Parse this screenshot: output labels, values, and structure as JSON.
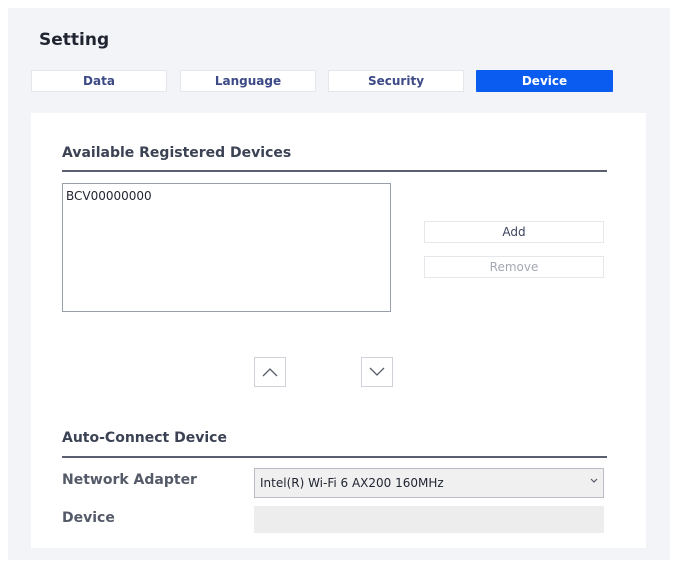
{
  "header": {
    "title": "Setting"
  },
  "tabs": [
    {
      "label": "Data",
      "active": false
    },
    {
      "label": "Language",
      "active": false
    },
    {
      "label": "Security",
      "active": false
    },
    {
      "label": "Device",
      "active": true
    }
  ],
  "registered": {
    "section_title": "Available Registered Devices",
    "items": [
      "BCV00000000"
    ],
    "add_label": "Add",
    "remove_label": "Remove",
    "up_icon": "chevron-up-icon",
    "down_icon": "chevron-down-icon"
  },
  "auto_connect": {
    "section_title": "Auto-Connect Device",
    "network_adapter_label": "Network Adapter",
    "network_adapter_value": "Intel(R) Wi-Fi 6 AX200 160MHz",
    "device_label": "Device",
    "device_value": ""
  },
  "colors": {
    "accent": "#0a5cf0",
    "tab_text": "#3c4a86",
    "background": "#f3f4f7"
  }
}
